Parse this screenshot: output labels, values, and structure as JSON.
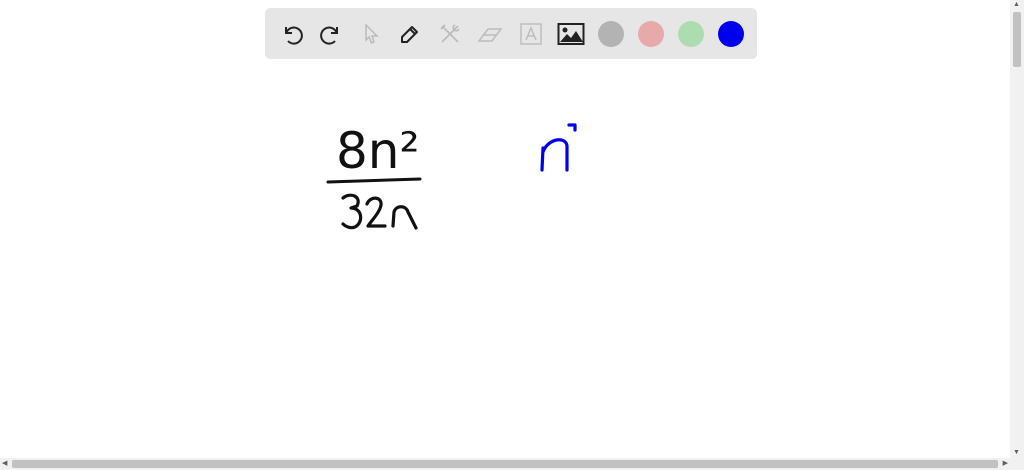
{
  "toolbar": {
    "tools": [
      {
        "name": "undo",
        "icon": "undo-icon",
        "enabled": true
      },
      {
        "name": "redo",
        "icon": "redo-icon",
        "enabled": true
      },
      {
        "name": "select",
        "icon": "cursor-icon",
        "enabled": false
      },
      {
        "name": "pen",
        "icon": "pencil-icon",
        "enabled": true
      },
      {
        "name": "tools",
        "icon": "wrench-icon",
        "enabled": false
      },
      {
        "name": "eraser",
        "icon": "eraser-icon",
        "enabled": false
      },
      {
        "name": "text",
        "icon": "text-icon",
        "enabled": false
      },
      {
        "name": "image",
        "icon": "image-icon",
        "enabled": true
      }
    ],
    "colors": [
      "#b3b3b3",
      "#e8a9ab",
      "#addcb0",
      "#0000ee"
    ],
    "selected_color": "#0000ee"
  },
  "handwriting": {
    "numerator": "8n²",
    "denominator": "32n",
    "result": "n"
  }
}
